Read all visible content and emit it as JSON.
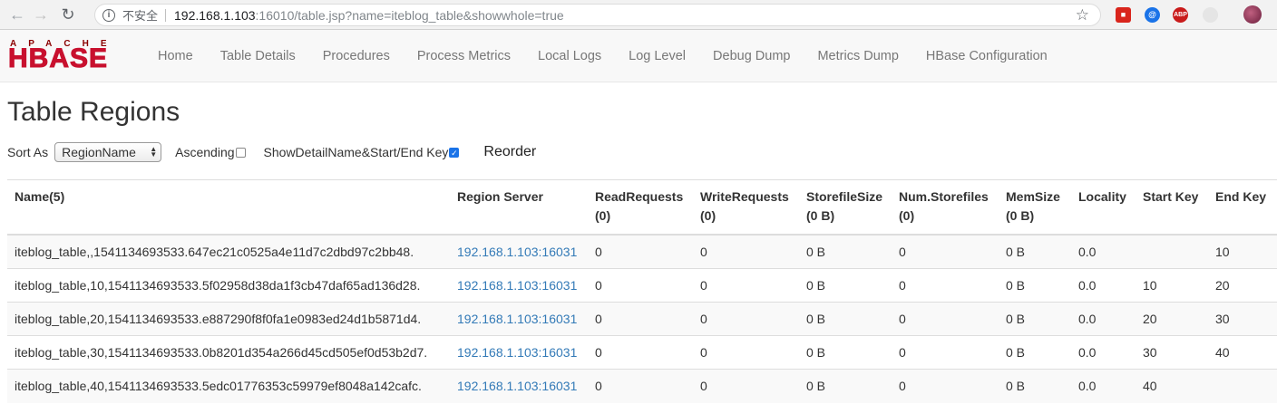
{
  "browser": {
    "insecure_label": "不安全",
    "url_host": "192.168.1.103",
    "url_rest": ":16010/table.jsp?name=iteblog_table&showwhole=true"
  },
  "logo": {
    "top": "APACHE",
    "main": "HBASE"
  },
  "nav": [
    "Home",
    "Table Details",
    "Procedures",
    "Process Metrics",
    "Local Logs",
    "Log Level",
    "Debug Dump",
    "Metrics Dump",
    "HBase Configuration"
  ],
  "page_title": "Table Regions",
  "controls": {
    "sort_label": "Sort As",
    "sort_value": "RegionName",
    "ascending_label": "Ascending",
    "ascending_checked": false,
    "detail_label": "ShowDetailName&Start/End Key",
    "detail_checked": true,
    "reorder_label": "Reorder"
  },
  "table": {
    "headers": [
      [
        "Name(5)",
        ""
      ],
      [
        "Region Server",
        ""
      ],
      [
        "ReadRequests",
        "(0)"
      ],
      [
        "WriteRequests",
        "(0)"
      ],
      [
        "StorefileSize",
        "(0 B)"
      ],
      [
        "Num.Storefiles",
        "(0)"
      ],
      [
        "MemSize",
        "(0 B)"
      ],
      [
        "Locality",
        ""
      ],
      [
        "Start Key",
        ""
      ],
      [
        "End Key",
        ""
      ]
    ],
    "rows": [
      [
        "iteblog_table,,1541134693533.647ec21c0525a4e11d7c2dbd97c2bb48.",
        "192.168.1.103:16031",
        "0",
        "0",
        "0 B",
        "0",
        "0 B",
        "0.0",
        "",
        "10"
      ],
      [
        "iteblog_table,10,1541134693533.5f02958d38da1f3cb47daf65ad136d28.",
        "192.168.1.103:16031",
        "0",
        "0",
        "0 B",
        "0",
        "0 B",
        "0.0",
        "10",
        "20"
      ],
      [
        "iteblog_table,20,1541134693533.e887290f8f0fa1e0983ed24d1b5871d4.",
        "192.168.1.103:16031",
        "0",
        "0",
        "0 B",
        "0",
        "0 B",
        "0.0",
        "20",
        "30"
      ],
      [
        "iteblog_table,30,1541134693533.0b8201d354a266d45cd505ef0d53b2d7.",
        "192.168.1.103:16031",
        "0",
        "0",
        "0 B",
        "0",
        "0 B",
        "0.0",
        "30",
        "40"
      ],
      [
        "iteblog_table,40,1541134693533.5edc01776353c59979ef8048a142cafc.",
        "192.168.1.103:16031",
        "0",
        "0",
        "0 B",
        "0",
        "0 B",
        "0.0",
        "40",
        ""
      ]
    ]
  }
}
